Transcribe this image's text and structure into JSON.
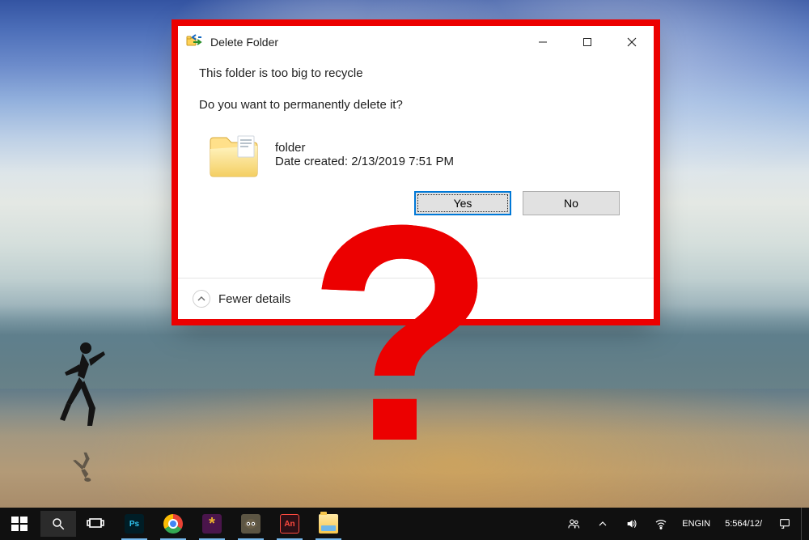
{
  "overlay": {
    "question_mark": "?"
  },
  "dialog": {
    "title": "Delete Folder",
    "message1": "This folder is too big to recycle",
    "message2": "Do you want to permanently delete it?",
    "item": {
      "name": "folder",
      "date_label": "Date created: 2/13/2019 7:51 PM"
    },
    "yes_label": "Yes",
    "no_label": "No",
    "details_toggle": "Fewer details"
  },
  "taskbar": {
    "apps": {
      "start": "Start",
      "search": "Search",
      "taskview": "Task View",
      "photoshop": "Ps",
      "chrome": "Chrome",
      "slack": "Slack",
      "gimp": "GIMP",
      "animate": "An",
      "explorer": "File Explorer"
    },
    "tray": {
      "people": "People",
      "tray_up": "Show hidden icons",
      "volume": "Volume",
      "network": "Network",
      "lang_primary": "ENG",
      "lang_secondary": "IN",
      "time": "5:56",
      "date": "4/12/",
      "notifications": "Action Center"
    }
  }
}
